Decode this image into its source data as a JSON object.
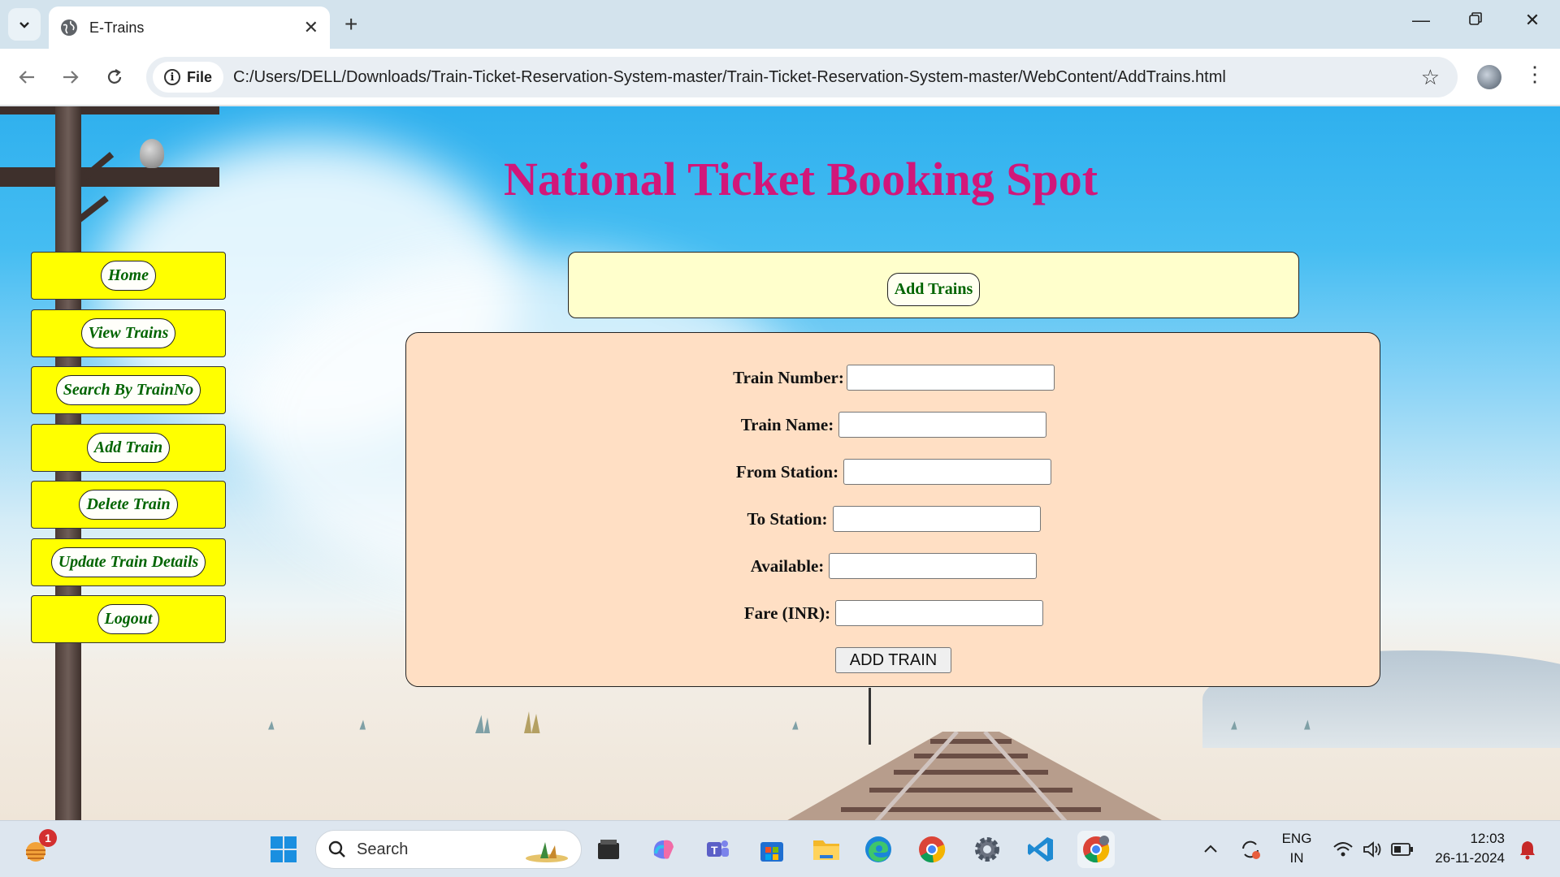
{
  "browser": {
    "tab_title": "E-Trains",
    "url_scheme_label": "File",
    "url": "C:/Users/DELL/Downloads/Train-Ticket-Reservation-System-master/Train-Ticket-Reservation-System-master/WebContent/AddTrains.html"
  },
  "page": {
    "heading": "National Ticket Booking Spot",
    "section_title": "Add Trains",
    "heading_color": "#d1177a",
    "link_color": "#006400"
  },
  "sidebar": {
    "items": [
      {
        "label": "Home"
      },
      {
        "label": "View Trains"
      },
      {
        "label": "Search By TrainNo"
      },
      {
        "label": "Add Train"
      },
      {
        "label": "Delete Train"
      },
      {
        "label": "Update Train Details"
      },
      {
        "label": "Logout"
      }
    ]
  },
  "form": {
    "fields": [
      {
        "label": "Train Number:",
        "value": ""
      },
      {
        "label": "Train Name:",
        "value": ""
      },
      {
        "label": "From Station:",
        "value": ""
      },
      {
        "label": "To Station:",
        "value": ""
      },
      {
        "label": "Available:",
        "value": ""
      },
      {
        "label": "Fare (INR):",
        "value": ""
      }
    ],
    "submit_label": "ADD TRAIN"
  },
  "taskbar": {
    "search_label": "Search",
    "weather_badge": "1",
    "language_top": "ENG",
    "language_bottom": "IN",
    "time": "12:03",
    "date": "26-11-2024",
    "pinned_icons": [
      "start-icon",
      "file-manager-icon",
      "copilot-icon",
      "teams-icon",
      "store-icon",
      "folder-icon",
      "edge-icon",
      "chrome-icon",
      "settings-icon",
      "vscode-icon",
      "chrome-profile-icon"
    ]
  }
}
